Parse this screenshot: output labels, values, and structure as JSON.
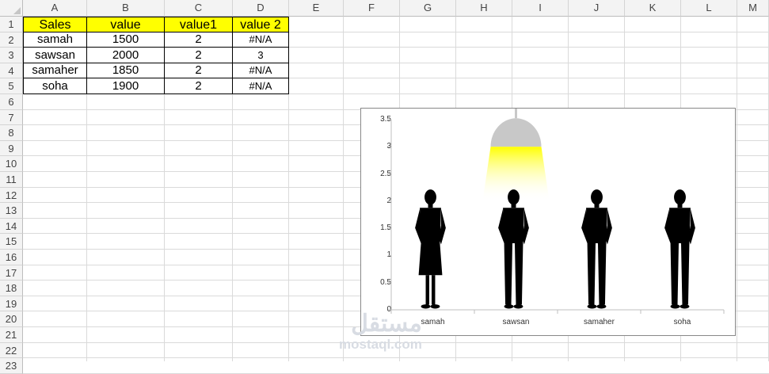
{
  "columns": [
    "A",
    "B",
    "C",
    "D",
    "E",
    "F",
    "G",
    "H",
    "I",
    "J",
    "K",
    "L",
    "M"
  ],
  "rows": [
    "1",
    "2",
    "3",
    "4",
    "5",
    "6",
    "7",
    "8",
    "9",
    "10",
    "11",
    "12",
    "13",
    "14",
    "15",
    "16",
    "17",
    "18",
    "19",
    "20",
    "21",
    "22",
    "23"
  ],
  "table": {
    "headers": [
      "Sales",
      "value",
      "value1",
      "value 2"
    ],
    "rows": [
      [
        "samah",
        "1500",
        "2",
        "#N/A"
      ],
      [
        "sawsan",
        "2000",
        "2",
        "3"
      ],
      [
        "samaher",
        "1850",
        "2",
        "#N/A"
      ],
      [
        "soha",
        "1900",
        "2",
        "#N/A"
      ]
    ]
  },
  "chart_data": {
    "type": "bar",
    "categories": [
      "samah",
      "sawsan",
      "samaher",
      "soha"
    ],
    "series": [
      {
        "values": [
          2,
          2,
          2,
          2
        ]
      },
      {
        "values": [
          null,
          3,
          null,
          null
        ]
      }
    ],
    "ylim": [
      0,
      3.5
    ],
    "yticks": [
      "0",
      "0.5",
      "1",
      "1.5",
      "2",
      "2.5",
      "3",
      "3.5"
    ],
    "grid": false,
    "colors": {
      "figure": "#000000",
      "lamp": "#c8c8c8",
      "light": "#ffff00"
    }
  },
  "watermark": {
    "arabic": "مستقل",
    "latin": "mostaql.com"
  }
}
